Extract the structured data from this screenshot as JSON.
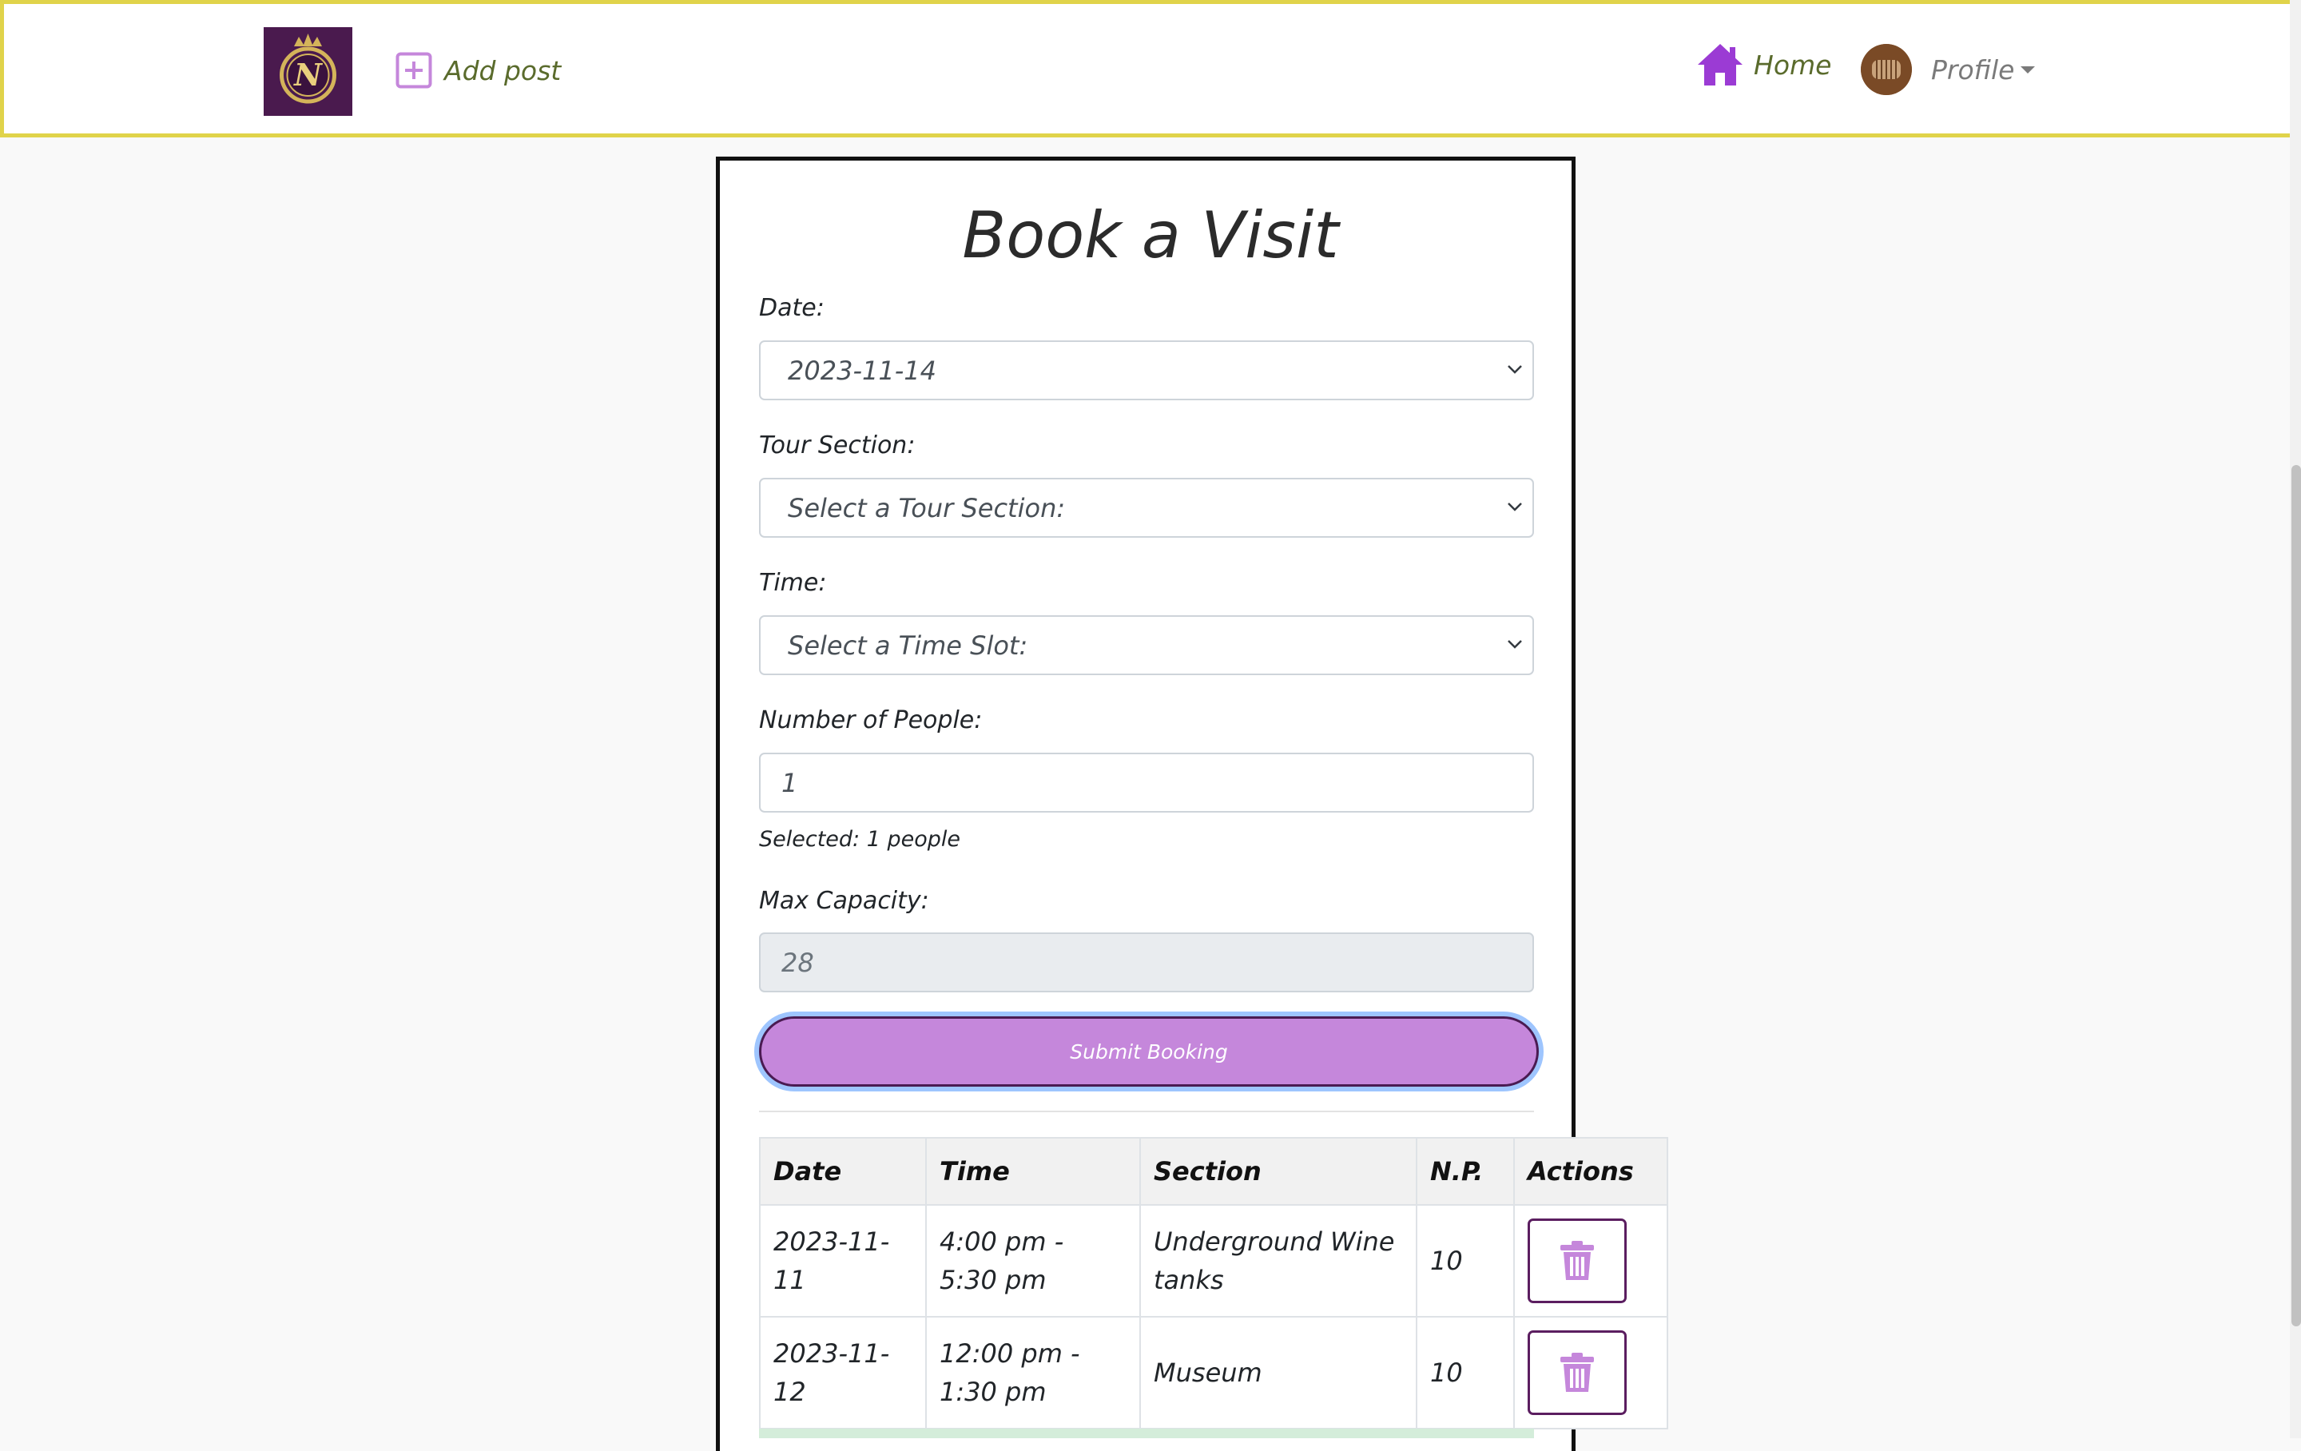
{
  "nav": {
    "logo_letter": "N",
    "add_post_label": "Add post",
    "home_label": "Home",
    "profile_label": "Profile",
    "icons": [
      "plus-square-icon",
      "home-icon",
      "avatar",
      "chevron-down-icon"
    ]
  },
  "form": {
    "title": "Book a Visit",
    "date": {
      "label": "Date:",
      "value": "2023-11-14"
    },
    "tour_section": {
      "label": "Tour Section:",
      "value": "Select a Tour Section:"
    },
    "time": {
      "label": "Time:",
      "value": "Select a Time Slot:"
    },
    "people": {
      "label": "Number of People:",
      "value": "1",
      "helper": "Selected: 1 people"
    },
    "max_capacity": {
      "label": "Max Capacity:",
      "value": "28"
    },
    "submit_label": "Submit Booking"
  },
  "bookings": {
    "headers": [
      "Date",
      "Time",
      "Section",
      "N.P.",
      "Actions"
    ],
    "rows": [
      {
        "date": "2023-11-11",
        "time": "4:00 pm - 5:30 pm",
        "section": "Underground Wine tanks",
        "np": "10"
      },
      {
        "date": "2023-11-12",
        "time": "12:00 pm - 1:30 pm",
        "section": "Museum",
        "np": "10"
      }
    ]
  },
  "colors": {
    "accent_purple": "#c587db",
    "icon_purple": "#9b3bd4",
    "navbar_border": "#e0d34a",
    "nav_text": "#5a6b2c"
  }
}
